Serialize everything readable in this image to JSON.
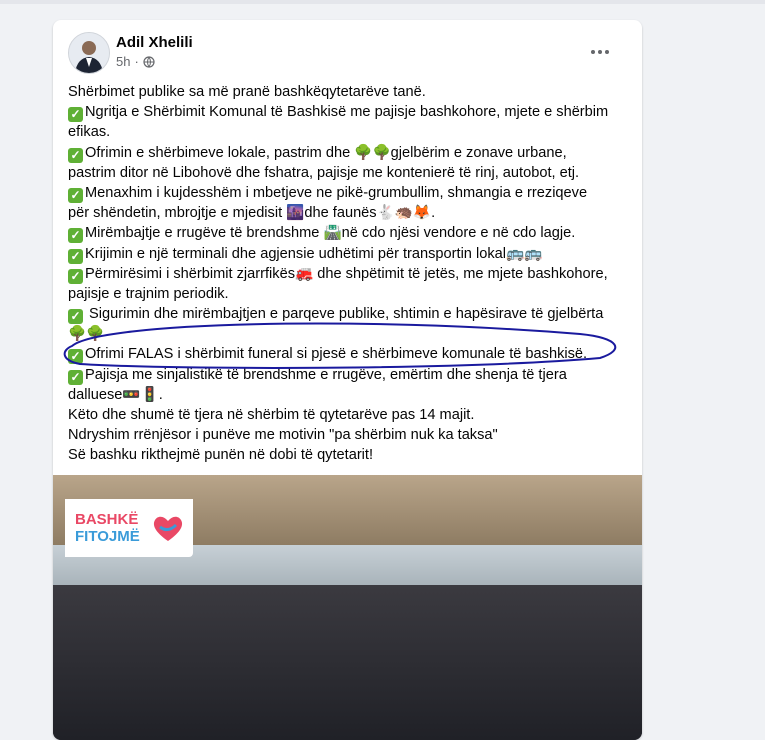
{
  "post": {
    "author": "Adil Xhelili",
    "time": "5h",
    "lines": [
      {
        "check": false,
        "text": "Shërbimet publike sa më pranë bashkëqytetarëve tanë."
      },
      {
        "check": true,
        "text": "Ngritja e Shërbimit Komunal të Bashkisë me pajisje bashkohore, mjete e shërbim"
      },
      {
        "check": false,
        "text": "efikas."
      },
      {
        "check": true,
        "text": "Ofrimin e shërbimeve lokale,  pastrim dhe 🌳🌳gjelbërim e zonave urbane,"
      },
      {
        "check": false,
        "text": "pastrim ditor në Libohovë dhe fshatra,  pajisje me kontenierë të rinj, autobot, etj."
      },
      {
        "check": true,
        "text": "Menaxhim i kujdesshëm i mbetjeve ne pikë-grumbullim, shmangia e rreziqeve"
      },
      {
        "check": false,
        "text": "për shëndetin, mbrojtje e mjedisit 🌆dhe faunës🐇🦔🦊."
      },
      {
        "check": true,
        "text": "Mirëmbajtje e rrugëve të brendshme 🛣️në cdo njësi vendore e në cdo lagje."
      },
      {
        "check": true,
        "text": "Krijimin e një terminali dhe agjensie udhëtimi për transportin lokal🚌🚌"
      },
      {
        "check": true,
        "text": "Përmirësimi i shërbimit zjarrfikës🚒 dhe shpëtimit të jetës,  me mjete bashkohore,"
      },
      {
        "check": false,
        "text": "pajisje e trajnim periodik."
      },
      {
        "check": true,
        "text": " Sigurimin dhe mirëmbajtjen e parqeve publike, shtimin e hapësirave të gjelbërta"
      },
      {
        "check": false,
        "text": "🌳🌳"
      },
      {
        "check": true,
        "text": "Ofrimi FALAS i shërbimit funeral si pjesë e shërbimeve komunale të bashkisë."
      },
      {
        "check": true,
        "text": "Pajisja me sinjalistikë të brendshme e rrugëve, emërtim dhe shenja të tjera"
      },
      {
        "check": false,
        "text": "dalluese🚥🚦."
      },
      {
        "check": false,
        "text": "Këto dhe shumë të tjera në shërbim të qytetarëve pas 14 majit."
      },
      {
        "check": false,
        "text": "Ndryshim rrënjësor i punëve me motivin \"pa shërbim nuk ka taksa\""
      },
      {
        "check": false,
        "text": "Së bashku rikthejmë punën në dobi të qytetarit!"
      }
    ],
    "check_glyph": "✓"
  },
  "photo": {
    "badge_line1": "BASHKË",
    "badge_line2": "FITOJMË"
  },
  "colors": {
    "check_green": "#5fb035",
    "annotation_blue": "#1a1a9e",
    "badge_pink": "#e94865",
    "badge_blue": "#3a9bd9"
  },
  "icons": [
    "globe-icon",
    "more-options-icon",
    "heart-logo-icon"
  ]
}
